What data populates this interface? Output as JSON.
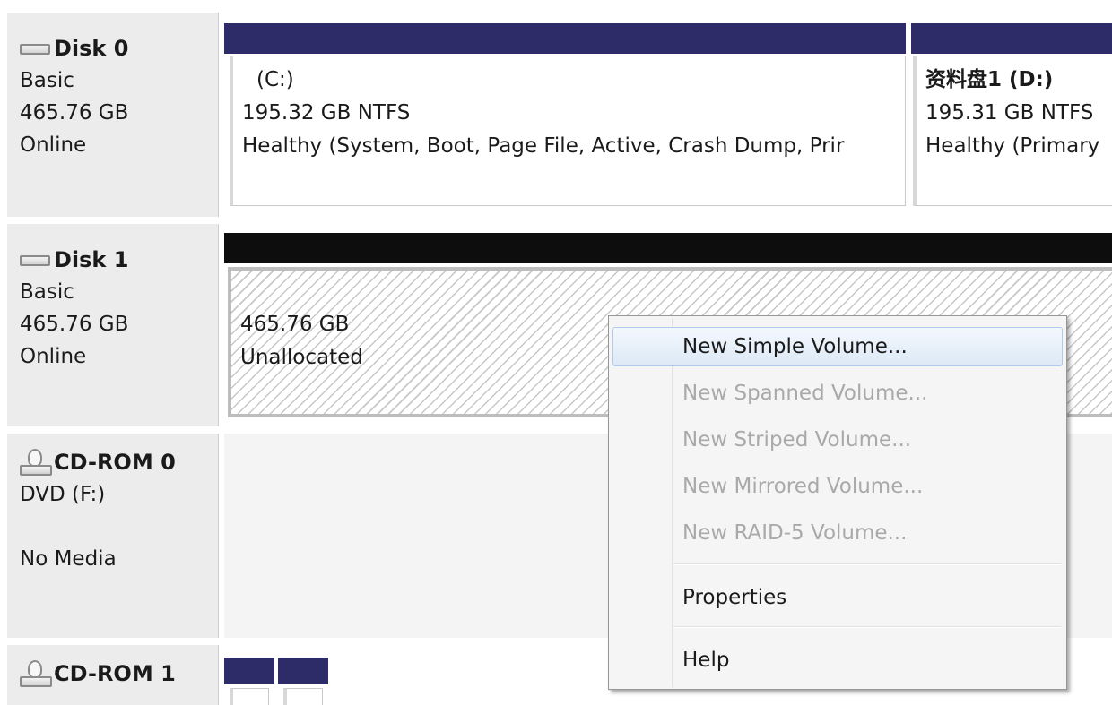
{
  "disks": [
    {
      "name": "Disk 0",
      "icon": "hard-disk-icon",
      "type": "Basic",
      "size": "465.76 GB",
      "status": "Online",
      "volumes": [
        {
          "name": "(C:)",
          "size_fs": "195.32 GB NTFS",
          "health": "Healthy (System, Boot, Page File, Active, Crash Dump, Prir",
          "bar_color": "#2e2b69"
        },
        {
          "name": "资料盘1 (D:)",
          "size_fs": "195.31 GB NTFS",
          "health": "Healthy (Primary",
          "bar_color": "#2e2b69"
        }
      ]
    },
    {
      "name": "Disk 1",
      "icon": "hard-disk-icon",
      "type": "Basic",
      "size": "465.76 GB",
      "status": "Online",
      "volumes": [
        {
          "size": "465.76 GB",
          "status": "Unallocated",
          "bar_color": "#0d0d0d"
        }
      ]
    },
    {
      "name": "CD-ROM 0",
      "icon": "cd-rom-icon",
      "type": "DVD (F:)",
      "status": "No Media"
    },
    {
      "name": "CD-ROM 1",
      "icon": "cd-rom-icon",
      "bar_color": "#2e2b69"
    }
  ],
  "context_menu": {
    "items": [
      {
        "label": "New Simple Volume...",
        "enabled": true,
        "highlighted": true
      },
      {
        "label": "New Spanned Volume...",
        "enabled": false
      },
      {
        "label": "New Striped Volume...",
        "enabled": false
      },
      {
        "label": "New Mirrored Volume...",
        "enabled": false
      },
      {
        "label": "New RAID-5 Volume...",
        "enabled": false
      },
      {
        "label": "Properties",
        "enabled": true
      },
      {
        "label": "Help",
        "enabled": true
      }
    ]
  },
  "colors": {
    "primary_partition_bar": "#2e2b69",
    "unallocated_bar": "#0d0d0d",
    "label_panel_bg": "#ececec",
    "menu_highlight_border": "#aecbee",
    "disabled_text": "#a9a9a9"
  }
}
